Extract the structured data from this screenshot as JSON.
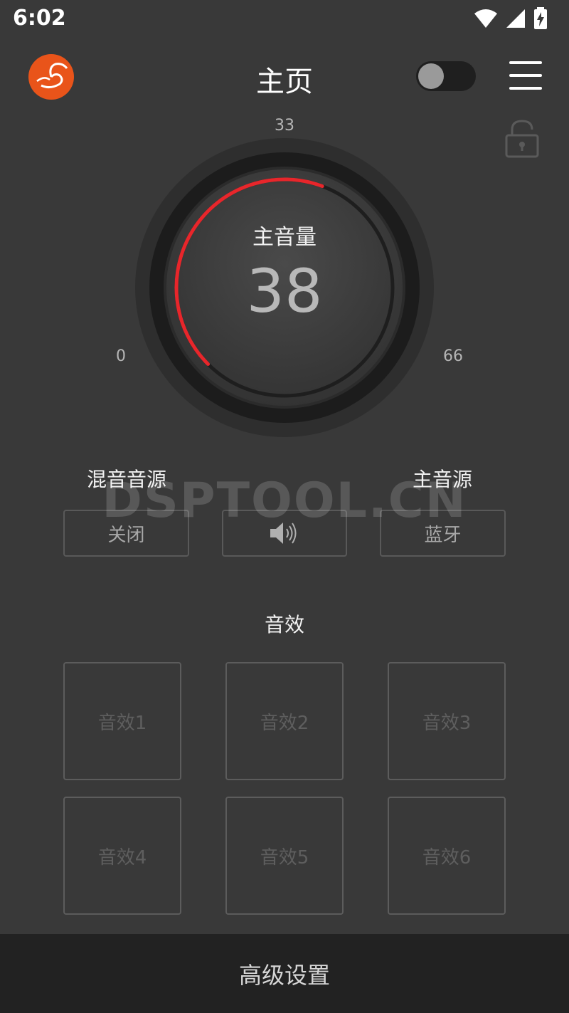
{
  "status_bar": {
    "time": "6:02",
    "icons": [
      "wifi-icon",
      "cell-signal-icon",
      "battery-charging-icon"
    ]
  },
  "header": {
    "title": "主页",
    "toggle_on": false
  },
  "dial": {
    "label": "主音量",
    "value": "38",
    "ticks": {
      "min": "0",
      "mid": "33",
      "max": "66"
    },
    "level": 38,
    "max_level": 66,
    "accent_color": "#e8262b"
  },
  "sources": {
    "mix_label": "混音音源",
    "main_label": "主音源",
    "mix_button": "关闭",
    "main_button": "蓝牙"
  },
  "watermark": "DSPTOOL.CN",
  "effects": {
    "title": "音效",
    "items": [
      "音效1",
      "音效2",
      "音效3",
      "音效4",
      "音效5",
      "音效6"
    ]
  },
  "bottom": {
    "label": "高级设置"
  }
}
